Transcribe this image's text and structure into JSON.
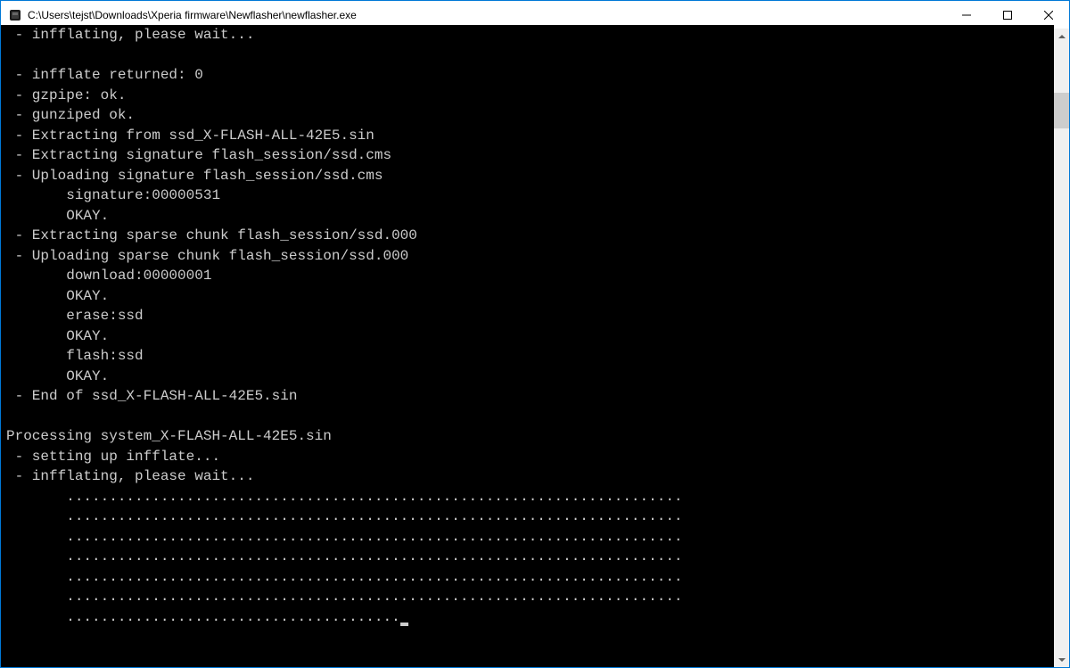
{
  "window": {
    "title": "C:\\Users\\tejst\\Downloads\\Xperia firmware\\Newflasher\\newflasher.exe"
  },
  "console": {
    "lines": [
      " - infflating, please wait...",
      "",
      " - infflate returned: 0",
      " - gzpipe: ok.",
      " - gunziped ok.",
      " - Extracting from ssd_X-FLASH-ALL-42E5.sin",
      " - Extracting signature flash_session/ssd.cms",
      " - Uploading signature flash_session/ssd.cms",
      "       signature:00000531",
      "       OKAY.",
      " - Extracting sparse chunk flash_session/ssd.000",
      " - Uploading sparse chunk flash_session/ssd.000",
      "       download:00000001",
      "       OKAY.",
      "       erase:ssd",
      "       OKAY.",
      "       flash:ssd",
      "       OKAY.",
      " - End of ssd_X-FLASH-ALL-42E5.sin",
      "",
      "Processing system_X-FLASH-ALL-42E5.sin",
      " - setting up infflate...",
      " - infflating, please wait...",
      "       ........................................................................",
      "       ........................................................................",
      "       ........................................................................",
      "       ........................................................................",
      "       ........................................................................",
      "       ........................................................................",
      "       ......................................."
    ]
  }
}
